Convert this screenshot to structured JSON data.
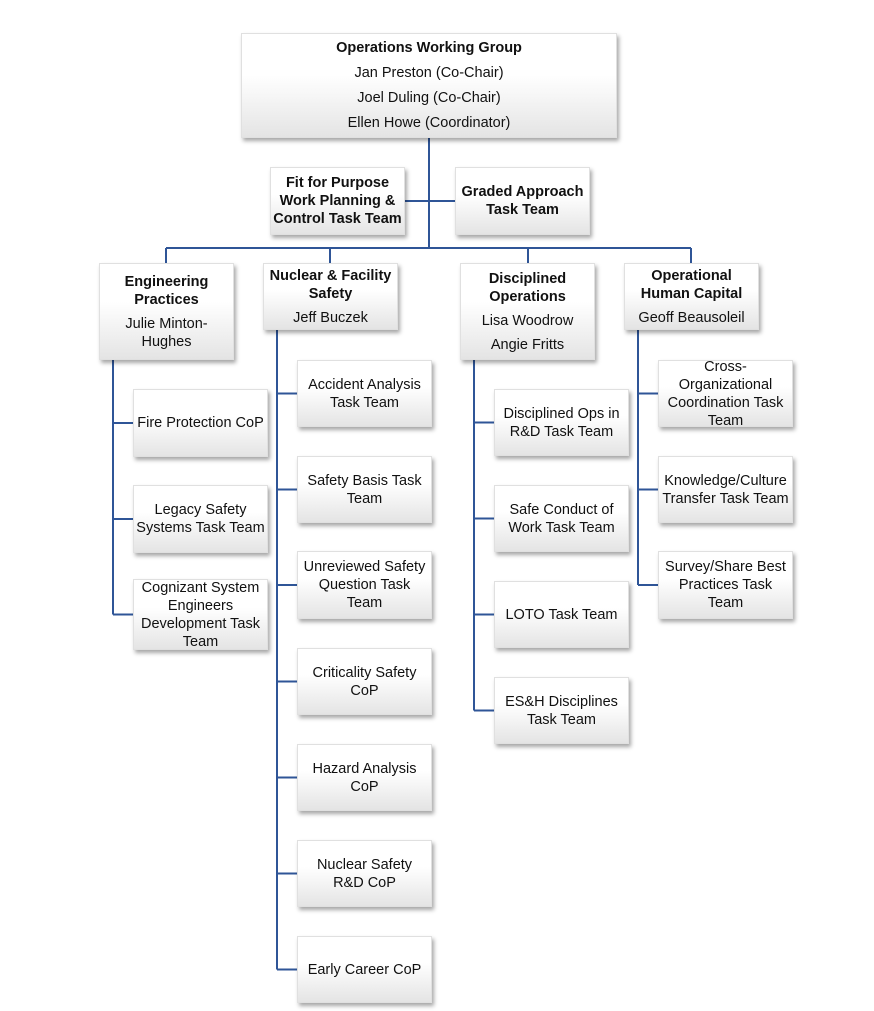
{
  "top": {
    "title": "Operations Working Group",
    "members": [
      "Jan Preston (Co-Chair)",
      "Joel Duling (Co-Chair)",
      "Ellen Howe (Coordinator)"
    ]
  },
  "side_teams": [
    "Fit for Purpose Work Planning & Control Task Team",
    "Graded Approach Task Team"
  ],
  "branches": [
    {
      "title": "Engineering Practices",
      "leads": [
        "Julie Minton-Hughes"
      ],
      "children": [
        "Fire Protection CoP",
        "Legacy Safety Systems Task Team",
        "Cognizant System Engineers Development Task Team"
      ]
    },
    {
      "title": "Nuclear & Facility Safety",
      "leads": [
        "Jeff Buczek"
      ],
      "children": [
        "Accident Analysis Task Team",
        "Safety Basis Task Team",
        "Unreviewed Safety Question Task Team",
        "Criticality Safety CoP",
        "Hazard Analysis CoP",
        "Nuclear Safety R&D CoP",
        "Early Career CoP"
      ]
    },
    {
      "title": "Disciplined Operations",
      "leads": [
        "Lisa Woodrow",
        "Angie Fritts"
      ],
      "children": [
        "Disciplined Ops in R&D Task Team",
        "Safe Conduct of Work Task Team",
        "LOTO Task Team",
        "ES&H Disciplines Task Team"
      ]
    },
    {
      "title": "Operational Human Capital",
      "leads": [
        "Geoff Beausoleil"
      ],
      "children": [
        "Cross-Organizational Coordination Task Team",
        "Knowledge/Culture Transfer Task Team",
        "Survey/Share Best Practices Task Team"
      ]
    }
  ],
  "colors": {
    "connector": "#2f5597"
  }
}
